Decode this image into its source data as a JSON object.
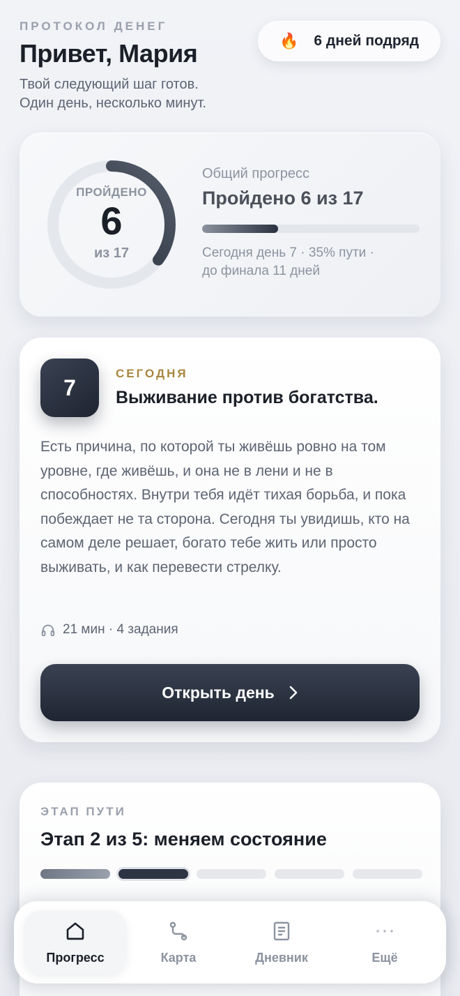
{
  "header": {
    "brand": "ПРОТОКОЛ ДЕНЕГ",
    "greeting": "Привет, Мария",
    "subtitle_line1": "Твой следующий шаг готов.",
    "subtitle_line2": "Один день, несколько минут.",
    "streak_icon": "fire-icon",
    "streak_label": "6 дней подряд"
  },
  "progress": {
    "ring_label": "ПРОЙДЕНО",
    "completed": "6",
    "total_label": "из 17",
    "completed_fraction": 0.3529,
    "label": "Общий прогресс",
    "title": "Пройдено 6 из 17",
    "bar_fraction": 0.35,
    "meta_line1": "Сегодня день 7 · 35% пути ·",
    "meta_line2": "до финала 11 дней"
  },
  "today": {
    "day_number": "7",
    "tag": "СЕГОДНЯ",
    "title": "Выживание против богатства.",
    "description": "Есть причина, по которой ты живёшь ровно на том уровне, где живёшь, и она не в лени и не в способностях. Внутри тебя идёт тихая борьба, и пока побеждает не та сторона. Сегодня ты увидишь, кто на самом деле решает, богато тебе жить или просто выживать, и как перевести стрелку.",
    "meta_icon": "headphones-icon",
    "meta": "21 мин · 4 задания",
    "button_label": "Открыть день"
  },
  "stage": {
    "tag": "ЭТАП ПУТИ",
    "title": "Этап 2 из 5: меняем состояние",
    "segments_total": 5,
    "segments_done": 1,
    "segment_active": 2
  },
  "tabbar": {
    "items": [
      {
        "label": "Прогресс",
        "icon": "home-icon",
        "active": true
      },
      {
        "label": "Карта",
        "icon": "route-icon",
        "active": false
      },
      {
        "label": "Дневник",
        "icon": "journal-icon",
        "active": false
      },
      {
        "label": "Ещё",
        "icon": "more-icon",
        "active": false
      }
    ]
  },
  "colors": {
    "accent_dark": "#1f2532",
    "today_tag": "#a8863f",
    "muted": "#8c93a0"
  }
}
